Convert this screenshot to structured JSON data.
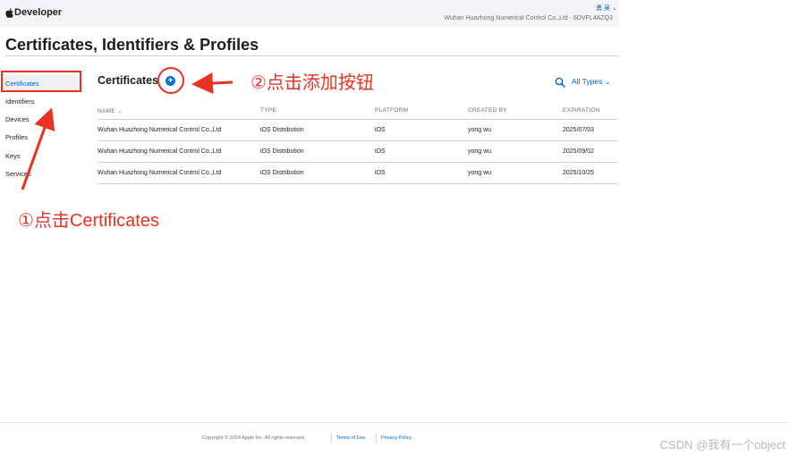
{
  "header": {
    "brand": "Developer",
    "user_name": "勇 吴",
    "team": "Wuhan Huazhong Numerical Control Co.,Ltd - 6DVFL4AZQ3"
  },
  "page": {
    "title": "Certificates, Identifiers & Profiles"
  },
  "sidebar": {
    "items": [
      {
        "label": "Certificates",
        "active": true
      },
      {
        "label": "Identifiers"
      },
      {
        "label": "Devices"
      },
      {
        "label": "Profiles"
      },
      {
        "label": "Keys"
      },
      {
        "label": "Services"
      }
    ]
  },
  "section": {
    "title": "Certificates",
    "add_symbol": "+",
    "filter_label": "All Types ⌄"
  },
  "table": {
    "columns": [
      "NAME ⌄",
      "TYPE",
      "PLATFORM",
      "CREATED BY",
      "EXPIRATION"
    ],
    "rows": [
      [
        "Wuhan Huazhong Numerical Control Co.,Ltd",
        "iOS Distribution",
        "iOS",
        "yong wu",
        "2025/07/03"
      ],
      [
        "Wuhan Huazhong Numerical Control Co.,Ltd",
        "iOS Distribution",
        "iOS",
        "yong wu",
        "2025/09/02"
      ],
      [
        "Wuhan Huazhong Numerical Control Co.,Ltd",
        "iOS Distribution",
        "iOS",
        "yong wu",
        "2025/10/25"
      ]
    ]
  },
  "annotations": {
    "step1": "①点击Certificates",
    "step2": "②点击添加按钮",
    "color": "#ea3223"
  },
  "footer": {
    "copyright": "Copyright © 2024 Apple Inc. All rights reserved.",
    "terms": "Terms of Use",
    "privacy": "Privacy Policy"
  },
  "watermark": "CSDN @我有一个object",
  "colors": {
    "accent": "#0071e3",
    "link": "#0066cc",
    "annotation": "#ea3223"
  }
}
